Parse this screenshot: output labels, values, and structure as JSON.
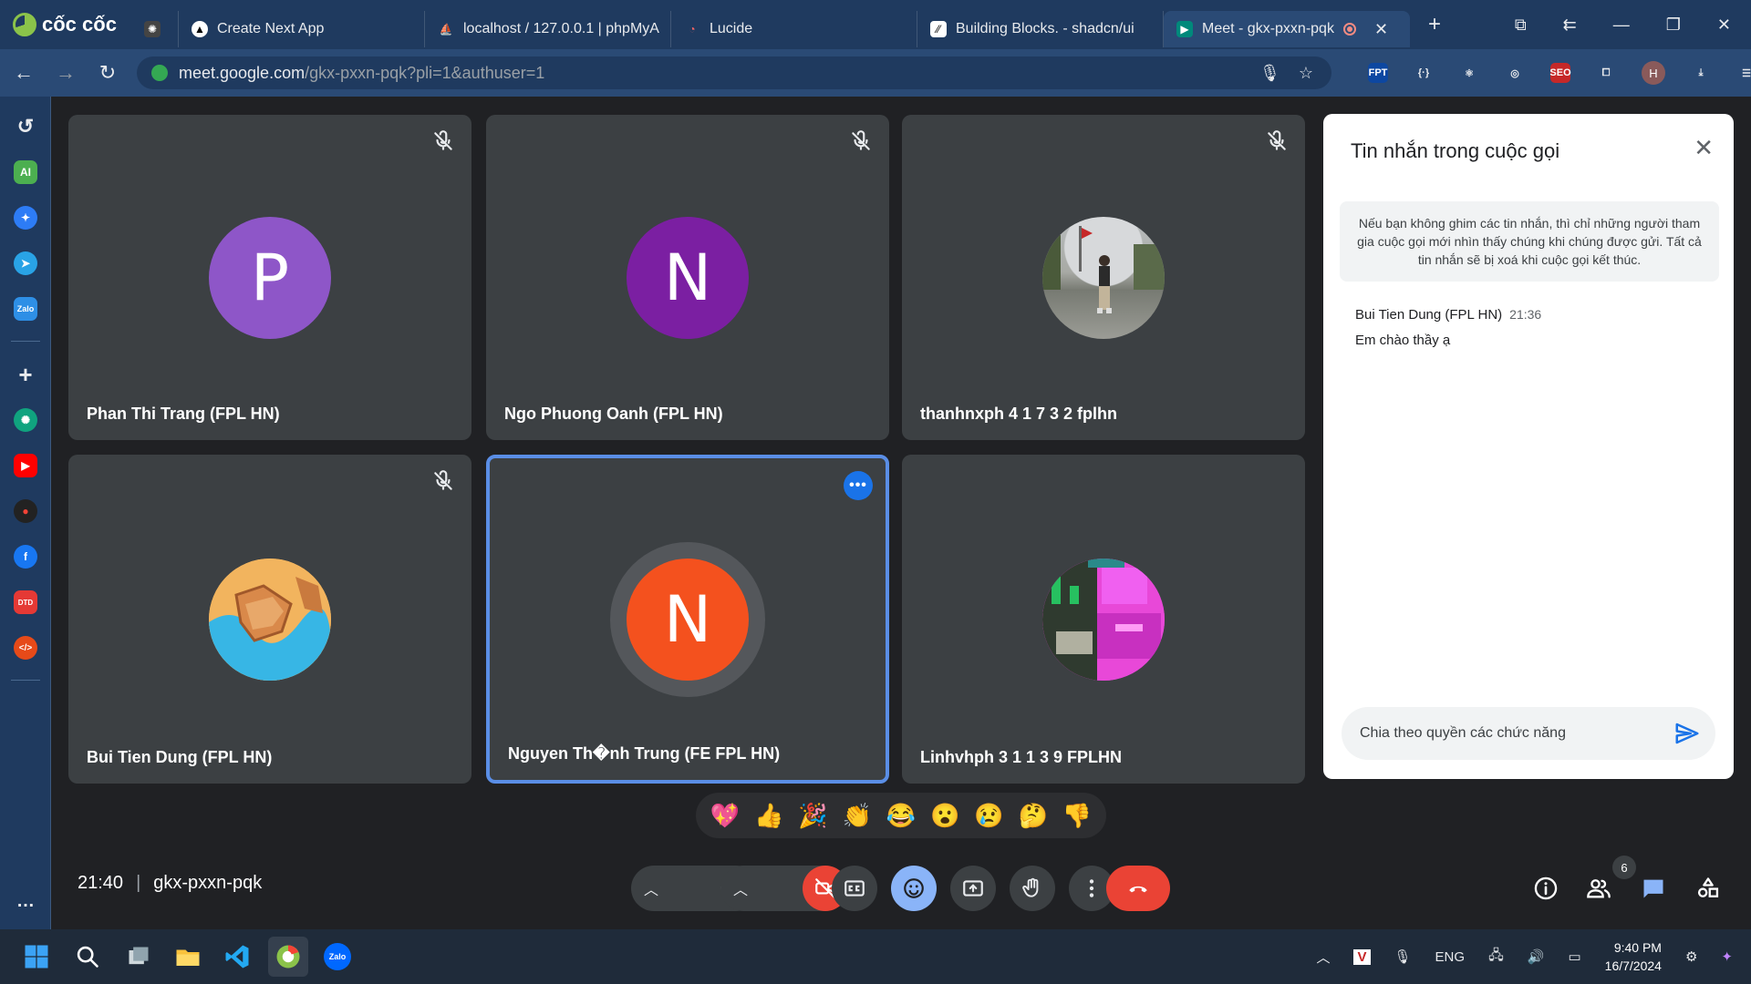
{
  "browser": {
    "brand": "cốc cốc",
    "tabs": [
      {
        "title": "Create Next App",
        "icon": "next-icon"
      },
      {
        "title": "localhost / 127.0.0.1 | phpMyA",
        "icon": "phpmyadmin-icon"
      },
      {
        "title": "Lucide",
        "icon": "lucide-icon"
      },
      {
        "title": "Building Blocks. - shadcn/ui",
        "icon": "shadcn-icon"
      },
      {
        "title": "Meet - gkx-pxxn-pqk",
        "icon": "meet-icon",
        "active": true
      }
    ],
    "url_host": "meet.google.com",
    "url_path": "/gkx-pxxn-pqk?pli=1&authuser=1",
    "profile_initial": "H"
  },
  "sidebar": {
    "items": [
      "history-icon",
      "ai-icon",
      "messenger-icon",
      "telegram-icon",
      "zalo-icon",
      "add-icon",
      "chatgpt-icon",
      "youtube-icon",
      "extension-icon",
      "facebook-icon",
      "dtd-icon",
      "devtools-icon"
    ],
    "ai_label": "AI",
    "zalo_label": "Zalo",
    "dtd_label": "DTD"
  },
  "participants": [
    {
      "name": "Phan Thi Trang (FPL HN)",
      "initial": "P",
      "color": "#8e56c8",
      "muted": true
    },
    {
      "name": "Ngo Phuong Oanh (FPL HN)",
      "initial": "N",
      "color": "#7b1fa2",
      "muted": true
    },
    {
      "name": "thanhnxph 4 1 7 3 2 fplhn",
      "initial": "",
      "color": "#8d8d8d",
      "muted": true,
      "photo": true
    },
    {
      "name": "Bui Tien Dung (FPL HN)",
      "initial": "",
      "color": "#e6a04a",
      "muted": true,
      "photo": true
    },
    {
      "name": "Nguyen Th�nh Trung (FE FPL HN)",
      "initial": "N",
      "color": "#f4511e",
      "muted": false,
      "speaking": true
    },
    {
      "name": "Linhvhph 3 1 1 3 9 FPLHN",
      "initial": "",
      "color": "#d63fd1",
      "muted": false,
      "photo": true
    }
  ],
  "chat": {
    "title": "Tin nhắn trong cuộc gọi",
    "note": "Nếu bạn không ghim các tin nhắn, thì chỉ những người tham gia cuộc gọi mới nhìn thấy chúng khi chúng được gửi. Tất cả tin nhắn sẽ bị xoá khi cuộc gọi kết thúc.",
    "messages": [
      {
        "sender": "Bui Tien Dung (FPL HN)",
        "time": "21:36",
        "text": "Em chào thầy ạ"
      }
    ],
    "input_value": "Chia theo quyền các chức năng"
  },
  "reactions": [
    "💖",
    "👍",
    "🎉",
    "👏",
    "😂",
    "😮",
    "😢",
    "🤔",
    "👎"
  ],
  "meeting": {
    "time": "21:40",
    "code": "gkx-pxxn-pqk",
    "participant_count": "6"
  },
  "taskbar": {
    "lang": "ENG",
    "time": "9:40 PM",
    "date": "16/7/2024",
    "zalo_label": "Zalo"
  }
}
